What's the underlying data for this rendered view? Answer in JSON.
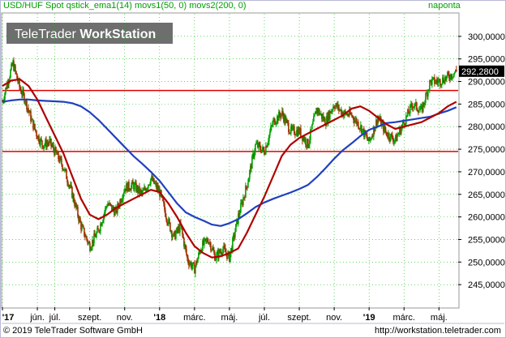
{
  "header": {
    "title": "USD/HUF Spot qstick_ema1(14) movs1(50, 0) movs2(200, 0)",
    "interval": "naponta"
  },
  "watermark": {
    "brand": "TeleTrader",
    "product": "WorkStation"
  },
  "footer": {
    "copyright": "© 2019 TeleTrader Software GmbH",
    "url": "http://workstation.teletrader.com"
  },
  "last_price_label": "292,2800",
  "colors": {
    "frame": "#b8b8d8",
    "header_text": "#00a000",
    "bull_candle": "#00a000",
    "bear_candle": "#a03000",
    "ma50": "#b00000",
    "ma200": "#2040c0",
    "hline": "#e00000",
    "grid": "#00c000"
  },
  "chart_data": {
    "type": "candlestick",
    "series": [
      {
        "name": "USD/HUF Spot",
        "kind": "price"
      },
      {
        "name": "movs1(50, 0)",
        "kind": "moving-average"
      },
      {
        "name": "movs2(200, 0)",
        "kind": "moving-average"
      }
    ],
    "ylim": [
      240000,
      305000
    ],
    "y_ticks": [
      245000,
      250000,
      255000,
      260000,
      265000,
      270000,
      275000,
      280000,
      285000,
      290000,
      295000,
      300000
    ],
    "y_tick_labels": [
      "245,0000",
      "250,0000",
      "255,0000",
      "260,0000",
      "265,0000",
      "270,0000",
      "275,0000",
      "280,0000",
      "285,0000",
      "290,0000",
      "295,0000",
      "300,0000"
    ],
    "x_tick_labels": [
      "'17",
      "jún.",
      "júl.",
      "szept.",
      "nov.",
      "'18",
      "márc.",
      "máj.",
      "júl.",
      "szept.",
      "nov.",
      "'19",
      "márc.",
      "máj."
    ],
    "x_tick_month": [
      4,
      6,
      7,
      9,
      11,
      13,
      15,
      17,
      19,
      21,
      23,
      25,
      27,
      29
    ],
    "xlim_month": [
      4,
      30.1
    ],
    "price": {
      "month": [
        4.0,
        4.3,
        4.6,
        5.0,
        5.3,
        5.7,
        6.0,
        6.3,
        6.7,
        7.0,
        7.5,
        8.0,
        8.5,
        9.0,
        9.5,
        10.0,
        10.5,
        11.0,
        11.5,
        12.0,
        12.5,
        13.0,
        13.4,
        13.8,
        14.2,
        14.6,
        15.0,
        15.4,
        15.8,
        16.2,
        16.6,
        17.0,
        17.5,
        18.0,
        18.5,
        19.0,
        19.5,
        20.0,
        20.5,
        21.0,
        21.5,
        22.0,
        22.5,
        23.0,
        23.5,
        24.0,
        24.5,
        25.0,
        25.5,
        26.0,
        26.5,
        27.0,
        27.5,
        28.0,
        28.5,
        29.0,
        29.5,
        30.0
      ],
      "close": [
        285500,
        290000,
        294000,
        288500,
        286000,
        281000,
        278000,
        276000,
        276500,
        274500,
        271000,
        265000,
        258000,
        253500,
        257000,
        263000,
        261000,
        266500,
        267000,
        265000,
        268500,
        265500,
        260000,
        255500,
        258000,
        250500,
        248500,
        253500,
        255000,
        251000,
        253000,
        251000,
        260000,
        267000,
        276000,
        274500,
        281000,
        283000,
        279000,
        279000,
        276000,
        284000,
        281000,
        285000,
        283000,
        282500,
        280000,
        276500,
        282000,
        278500,
        277000,
        281000,
        285000,
        283500,
        290000,
        290000,
        291000,
        292280
      ]
    },
    "ma50": {
      "month": [
        4.0,
        4.5,
        5.0,
        5.5,
        6.0,
        6.5,
        7.0,
        7.5,
        8.0,
        8.5,
        9.0,
        9.5,
        10.0,
        10.5,
        11.0,
        11.5,
        12.0,
        12.5,
        13.0,
        13.5,
        14.0,
        14.5,
        15.0,
        15.5,
        16.0,
        16.5,
        17.0,
        17.5,
        18.0,
        18.5,
        19.0,
        19.5,
        20.0,
        20.5,
        21.0,
        21.5,
        22.0,
        22.5,
        23.0,
        23.5,
        24.0,
        24.5,
        25.0,
        25.5,
        26.0,
        26.5,
        27.0,
        27.5,
        28.0,
        28.5,
        29.0,
        29.5,
        30.0
      ],
      "value": [
        289000,
        290200,
        290500,
        289000,
        286000,
        282000,
        278000,
        274000,
        269000,
        264000,
        260500,
        259500,
        260500,
        262000,
        263000,
        264000,
        265000,
        266000,
        265500,
        263000,
        260000,
        256500,
        253500,
        252000,
        251000,
        251300,
        252000,
        253000,
        256500,
        260500,
        264500,
        269000,
        273500,
        276000,
        277500,
        278500,
        279500,
        280500,
        281500,
        282500,
        284000,
        284500,
        283500,
        282000,
        280500,
        279500,
        280000,
        280500,
        281000,
        282000,
        283000,
        284500,
        285500
      ]
    },
    "ma200": {
      "month": [
        4.0,
        4.5,
        5.0,
        5.5,
        6.0,
        6.5,
        7.0,
        7.5,
        8.0,
        8.5,
        9.0,
        9.5,
        10.0,
        10.5,
        11.0,
        11.5,
        12.0,
        12.5,
        13.0,
        13.5,
        14.0,
        14.5,
        15.0,
        15.5,
        16.0,
        16.5,
        17.0,
        17.5,
        18.0,
        18.5,
        19.0,
        19.5,
        20.0,
        20.5,
        21.0,
        21.5,
        22.0,
        22.5,
        23.0,
        23.5,
        24.0,
        24.5,
        25.0,
        25.5,
        26.0,
        26.5,
        27.0,
        27.5,
        28.0,
        28.5,
        29.0,
        29.5,
        30.0
      ],
      "value": [
        285500,
        285800,
        286000,
        286000,
        285800,
        285700,
        285600,
        285500,
        285200,
        284500,
        283200,
        281500,
        279500,
        277500,
        275500,
        273500,
        271800,
        270000,
        268000,
        265500,
        263000,
        261000,
        260000,
        259200,
        258300,
        258000,
        258600,
        259500,
        260800,
        262200,
        263200,
        264000,
        264700,
        265400,
        266200,
        267100,
        268800,
        270800,
        272900,
        274800,
        276300,
        277900,
        279300,
        280000,
        280800,
        281000,
        281300,
        281600,
        281900,
        282200,
        282900,
        283500,
        284300
      ]
    },
    "horizontal_lines": [
      288000,
      274500
    ],
    "last_price": 292280,
    "grid": true,
    "y_axis_position": "right"
  }
}
